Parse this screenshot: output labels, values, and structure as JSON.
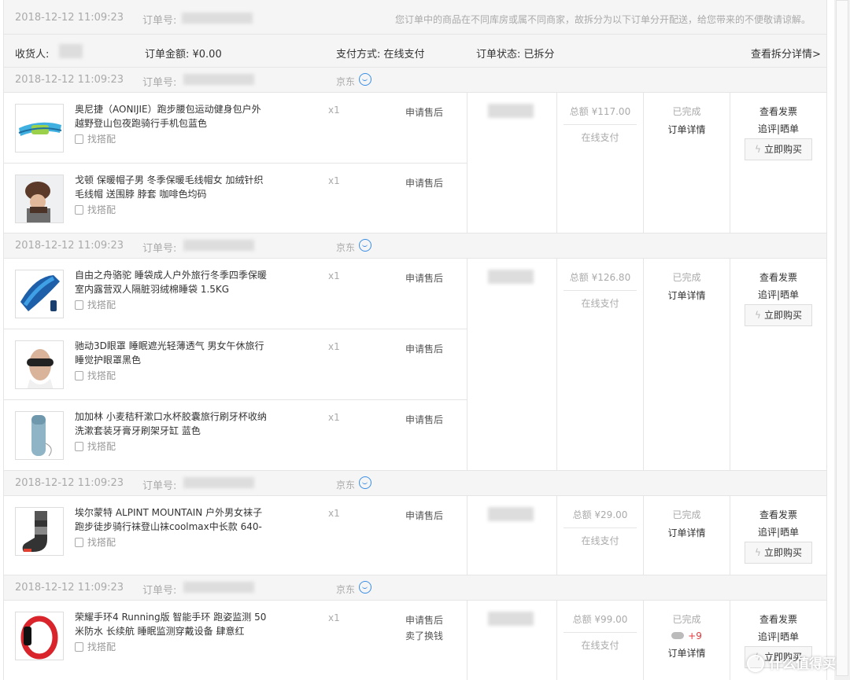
{
  "parent": {
    "date": "2018-12-12 11:09:23",
    "order_label": "订单号:",
    "notice": "您订单中的商品在不同库房或属不同商家，故拆分为以下订单分开配送，给您带来的不便敬请谅解。"
  },
  "summary": {
    "receiver_label": "收货人:",
    "amount_label": "订单金额: ¥0.00",
    "payment_label": "支付方式: 在线支付",
    "status_label": "订单状态: 已拆分",
    "detail_link": "查看拆分详情>"
  },
  "common": {
    "shop": "京东",
    "qty": "x1",
    "aftersale": "申请售后",
    "exchange": "卖了换钱",
    "match": "找搭配",
    "paid": "在线支付",
    "done": "已完成",
    "order_detail": "订单详情",
    "invoice": "查看发票",
    "review": "追评|晒单",
    "buy_again": "立即购买",
    "order_label": "订单号:"
  },
  "orders": [
    {
      "date": "2018-12-12 11:09:23",
      "total": "总额 ¥117.00",
      "items": [
        {
          "title": "奥尼捷（AONIJIE）跑步腰包运动健身包户外越野登山包夜跑骑行手机包蓝色",
          "thumb": "waist-bag"
        },
        {
          "title": "戈顿 保暖帽子男 冬季保暖毛线帽女 加绒针织毛线帽 送围脖 脖套 咖啡色均码",
          "thumb": "knit-hat"
        }
      ]
    },
    {
      "date": "2018-12-12 11:09:23",
      "total": "总额 ¥126.80",
      "items": [
        {
          "title": "自由之舟骆驼 睡袋成人户外旅行冬季四季保暖室内露营双人隔脏羽绒棉睡袋 1.5KG",
          "thumb": "sleeping-bag"
        },
        {
          "title": "驰动3D眼罩 睡眠遮光轻薄透气 男女午休旅行睡觉护眼罩黑色",
          "thumb": "eye-mask"
        },
        {
          "title": "加加林 小麦秸秆漱口水杯胶囊旅行刷牙杯收纳洗漱套装牙膏牙刷架牙缸 蓝色",
          "thumb": "travel-cup"
        }
      ]
    },
    {
      "date": "2018-12-12 11:09:23",
      "total": "总额 ¥29.00",
      "items": [
        {
          "title": "埃尔蒙特 ALPINT MOUNTAIN 户外男女袜子跑步徒步骑行袜登山袜coolmax中长款 640-",
          "thumb": "sock"
        }
      ]
    },
    {
      "date": "2018-12-12 11:09:23",
      "total": "总额 ¥99.00",
      "points": "+9",
      "items": [
        {
          "title": "荣耀手环4 Running版 智能手环 跑姿监测 50米防水 长续航 睡眠监测穿戴设备 肆意红",
          "thumb": "fitness-band"
        }
      ]
    }
  ],
  "watermark": "什么值得买"
}
